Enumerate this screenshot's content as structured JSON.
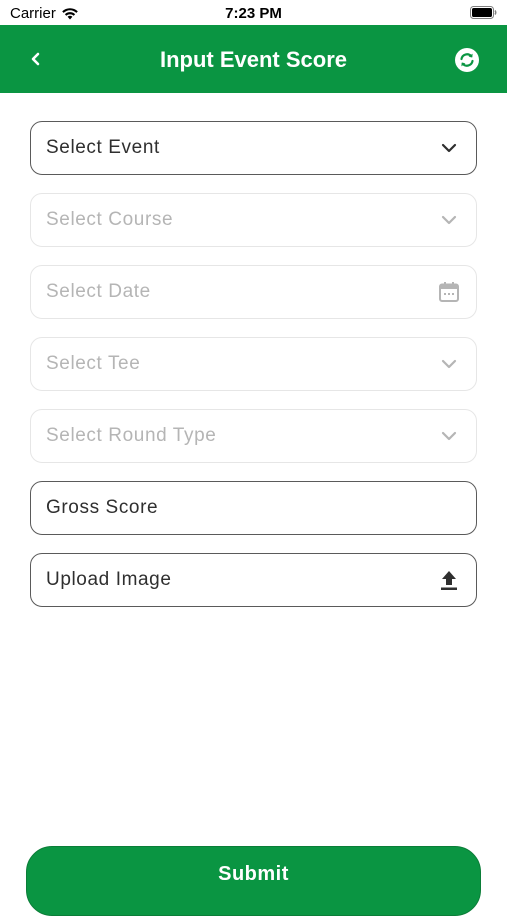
{
  "status_bar": {
    "carrier": "Carrier",
    "time": "7:23 PM",
    "icons": [
      "wifi-icon",
      "battery-icon"
    ]
  },
  "header": {
    "title": "Input Event Score",
    "back_icon": "chevron-left-icon",
    "refresh_icon": "refresh-icon",
    "background_color": "#0a9542"
  },
  "form": {
    "fields": [
      {
        "label": "Select Event",
        "state": "enabled",
        "icon": "chevron-down-icon"
      },
      {
        "label": "Select Course",
        "state": "disabled",
        "icon": "chevron-down-icon"
      },
      {
        "label": "Select Date",
        "state": "disabled",
        "icon": "calendar-icon"
      },
      {
        "label": "Select Tee",
        "state": "disabled",
        "icon": "chevron-down-icon"
      },
      {
        "label": "Select Round Type",
        "state": "disabled",
        "icon": "chevron-down-icon"
      },
      {
        "label": "Gross Score",
        "state": "enabled",
        "icon": ""
      },
      {
        "label": "Upload Image",
        "state": "enabled",
        "icon": "upload-icon"
      }
    ]
  },
  "submit": {
    "label": "Submit"
  }
}
